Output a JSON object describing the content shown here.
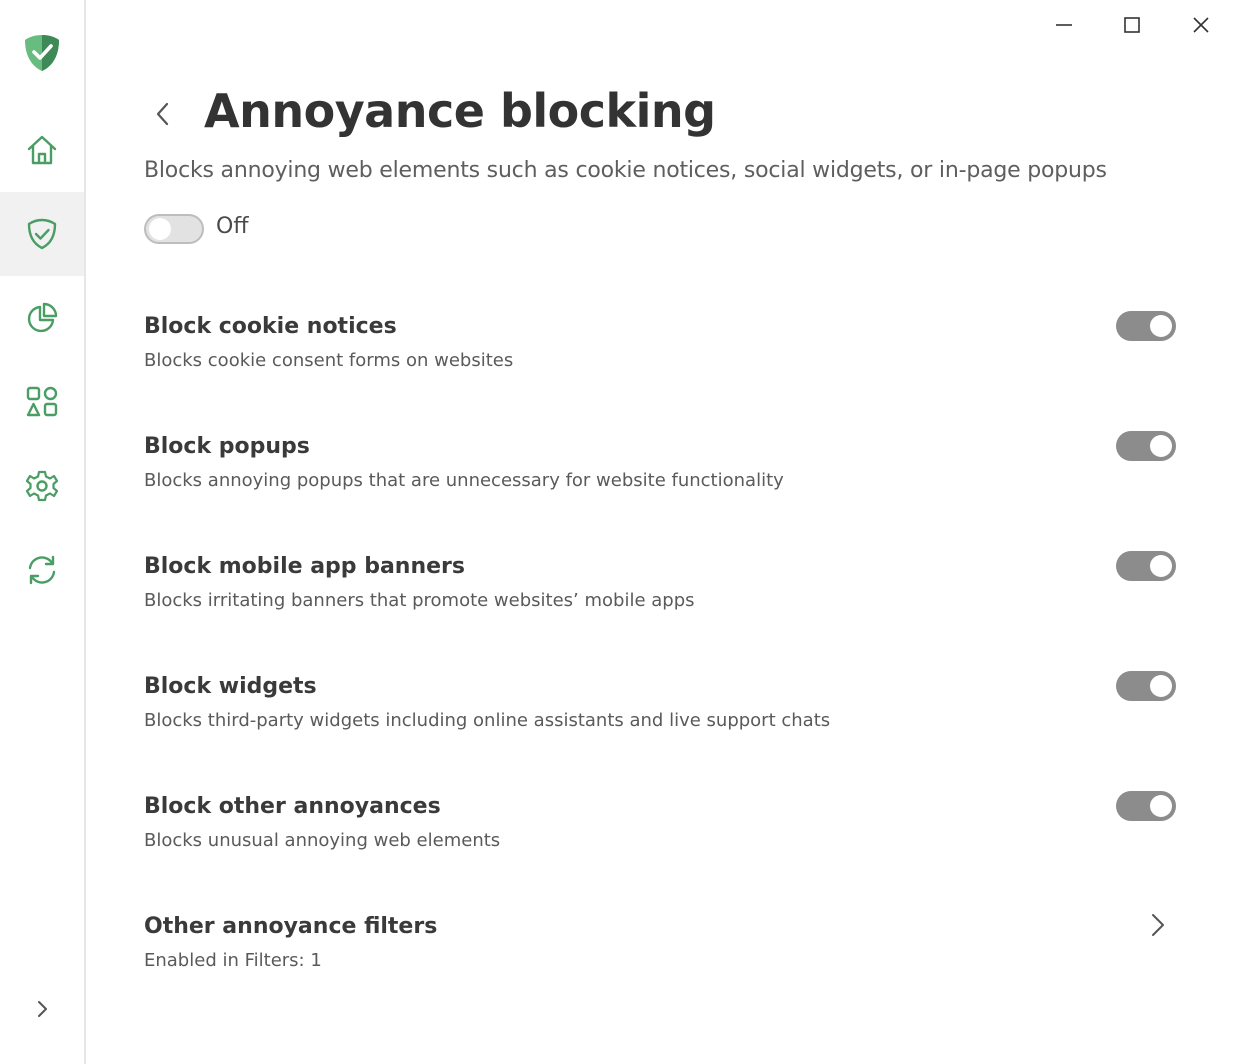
{
  "window": {
    "controls": [
      "minimize-icon",
      "maximize-icon",
      "close-icon"
    ]
  },
  "colors": {
    "brand": "#4a9d64",
    "toggle_disabled_on": "#8c8c8c",
    "sidebar_active_bg": "#f1f1f1"
  },
  "sidebar": {
    "logo_icon": "shield-check-logo-icon",
    "items": [
      {
        "icon": "home-icon",
        "active": false
      },
      {
        "icon": "shield-check-icon",
        "active": true
      },
      {
        "icon": "pie-chart-icon",
        "active": false
      },
      {
        "icon": "apps-shapes-icon",
        "active": false
      },
      {
        "icon": "gear-icon",
        "active": false
      },
      {
        "icon": "sync-icon",
        "active": false
      }
    ],
    "expand_icon": "chevron-right-icon"
  },
  "header": {
    "title": "Annoyance blocking",
    "description": "Blocks annoying web elements such as cookie notices, social widgets, or in-page popups",
    "master_toggle": {
      "state": "off",
      "label": "Off"
    }
  },
  "settings": [
    {
      "title": "Block cookie notices",
      "description": "Blocks cookie consent forms on websites",
      "toggle": "on-disabled"
    },
    {
      "title": "Block popups",
      "description": "Blocks annoying popups that are unnecessary for website functionality",
      "toggle": "on-disabled"
    },
    {
      "title": "Block mobile app banners",
      "description": "Blocks irritating banners that promote websites’ mobile apps",
      "toggle": "on-disabled"
    },
    {
      "title": "Block widgets",
      "description": "Blocks third-party widgets including online assistants and live support chats",
      "toggle": "on-disabled"
    },
    {
      "title": "Block other annoyances",
      "description": "Blocks unusual annoying web elements",
      "toggle": "on-disabled"
    }
  ],
  "other_filters": {
    "title": "Other annoyance filters",
    "description": "Enabled in Filters: 1"
  }
}
